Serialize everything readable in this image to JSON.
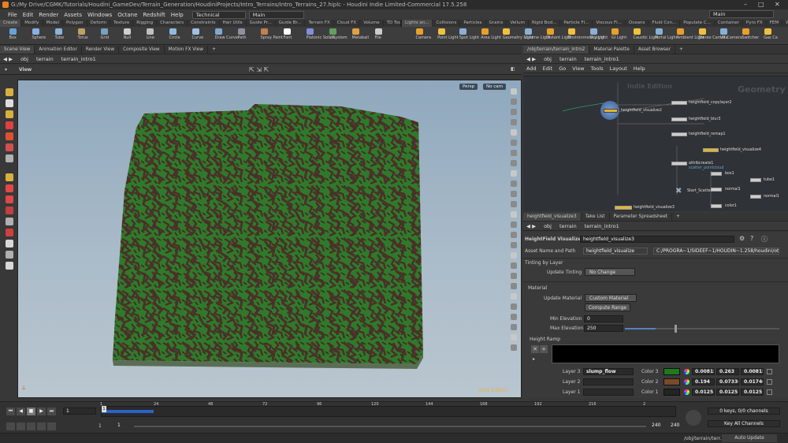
{
  "window": {
    "title": "G:/My Drive/CGMK/Tutorials/Houdini_GameDev/Terrain_Generation/HoudiniProjects/Intro_Terrains/Intro_Terrains_27.hiplc - Houdini Indie Limited-Commercial 17.5.258",
    "controls": [
      "–",
      "□",
      "✕"
    ]
  },
  "menu": {
    "items": [
      "File",
      "Edit",
      "Render",
      "Assets",
      "Windows",
      "Octane",
      "Redshift",
      "Help"
    ],
    "desktop": "Technical",
    "desktop_main": "Main",
    "right_desktop": "Main"
  },
  "shelf": {
    "tabs_left": [
      "Create",
      "Modify",
      "Model",
      "Polygon",
      "Deform",
      "Texture",
      "Rigging",
      "Characters",
      "Constraints",
      "Hair Utils",
      "Guide Pr...",
      "Guide Br...",
      "Terrain FX",
      "Cloud FX",
      "Volume",
      "TD Tools",
      "CGMK Tools",
      "Redshift"
    ],
    "tabs_right": [
      "Lights an...",
      "Collisions",
      "Particles",
      "Grains",
      "Vellum",
      "Rigid Bod...",
      "Particle Fl...",
      "Viscous Fl...",
      "Oceans",
      "Fluid Con...",
      "Populate C...",
      "Container",
      "Pyro FX",
      "FEM",
      "Wires",
      "Crowds",
      "Drive Sim"
    ],
    "tools_left": [
      "Box",
      "Sphere",
      "Tube",
      "Torus",
      "Grid",
      "Null",
      "Line",
      "Circle",
      "Curve",
      "Draw Curve",
      "Path",
      "Spray Paint",
      "Font",
      "Platonic Solids",
      "L-System",
      "Metaball",
      "File"
    ],
    "tools_right": [
      "Camera",
      "Point Light",
      "Spot Light",
      "Area Light",
      "Geometry Light",
      "Volume Light",
      "Distant Light",
      "Environment Light",
      "Sky Light",
      "GI Light",
      "Caustic Light",
      "Portal Light",
      "Ambient Light",
      "Stereo Camera",
      "VR Camera",
      "Switcher",
      "Gas Ca"
    ]
  },
  "left_pane": {
    "tabs": [
      "Scene View",
      "Animation Editor",
      "Render View",
      "Composite View",
      "Motion FX View"
    ],
    "path": [
      "obj",
      "terrain",
      "terrain_intro1"
    ],
    "view_label": "View",
    "persp": "Persp",
    "cam": "No cam",
    "watermark": "Indie Edition"
  },
  "network": {
    "tabs": [
      "/obj/terrain/terrain_intro2",
      "Material Palette",
      "Asset Browser"
    ],
    "path": [
      "obj",
      "terrain",
      "terrain_intro1"
    ],
    "menu": [
      "Add",
      "Edit",
      "Go",
      "View",
      "Tools",
      "Layout",
      "Help"
    ],
    "context_label": "Geometry",
    "watermark": "Indie Edition",
    "nodes": [
      "heightfield_copylayer2",
      "heightfield_visualize2",
      "heightfield_blur3",
      "heightfield_remap1",
      "heightfield_visualize4",
      "attribcreate1",
      "scatter_pointcloud",
      "box1",
      "tube1",
      "normal1",
      "Start_Scatter",
      "normal1",
      "color1",
      "heightfield_visualize3"
    ]
  },
  "params": {
    "tabs": [
      "heightfield_visualize3",
      "Take List",
      "Parameter Spreadsheet"
    ],
    "path": [
      "obj",
      "terrain",
      "terrain_intro1"
    ],
    "node_type": "HeightField Visualize",
    "node_name": "heightfield_visualize3",
    "asset_label": "Asset Name and Path",
    "asset_name": "heightfield_visualize",
    "asset_path": "C:/PROGRA~1/SIDEEF~1/HOUDIN~1.258/houdini/otls/O...",
    "tinting_section": "Tinting by Layer",
    "update_tinting_label": "Update Tinting",
    "update_tinting_value": "No Change",
    "material_section": "Material",
    "update_material_label": "Update Material",
    "update_material_value": "Custom Material",
    "compute_range": "Compute Range",
    "min_elev_label": "Min Elevation",
    "min_elev_value": "0",
    "max_elev_label": "Max Elevation",
    "max_elev_value": "250",
    "max_elev_fraction": 0.2,
    "height_ramp_label": "Height Ramp",
    "layers": [
      {
        "label": "Layer 3",
        "value": "slump_flow",
        "color_label": "Color 3",
        "swatch": "#1d7a1d",
        "r": "0.00815",
        "g": "0.263",
        "b": "0.00815"
      },
      {
        "label": "Layer 2",
        "value": "",
        "color_label": "Color 2",
        "swatch": "#7a4a2a",
        "r": "0.194",
        "g": "0.07336",
        "b": "0.01746"
      },
      {
        "label": "Layer 1",
        "value": "",
        "color_label": "Color 1",
        "swatch": "#232323",
        "r": "0.0125",
        "g": "0.0125",
        "b": "0.0125"
      }
    ]
  },
  "timeline": {
    "frame": "1",
    "start": "1",
    "end": "1",
    "range_end": "240",
    "range_end2": "240",
    "ticks": [
      "1",
      "24",
      "48",
      "72",
      "96",
      "120",
      "144",
      "168",
      "192",
      "216",
      "2"
    ],
    "keys": "0 keys, 0/0 channels",
    "key_all": "Key All Channels",
    "status_path": "/obj/terrain/terr...",
    "auto_update": "Auto Update"
  }
}
